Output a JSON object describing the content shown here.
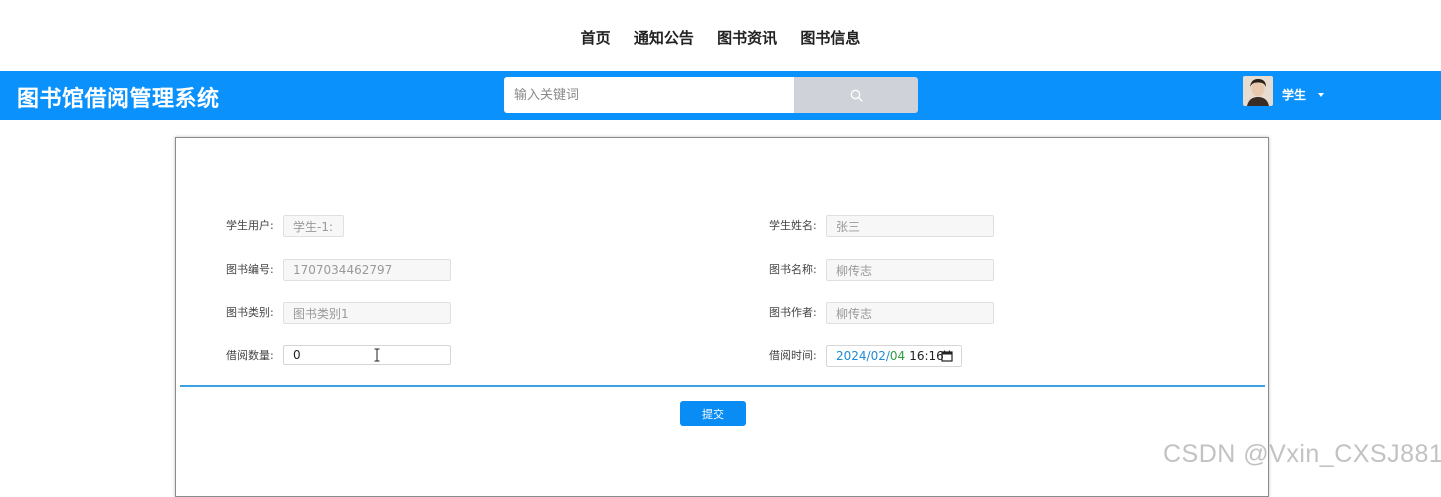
{
  "top_nav": {
    "items": [
      "首页",
      "通知公告",
      "图书资讯",
      "图书信息"
    ]
  },
  "header": {
    "title": "图书馆借阅管理系统",
    "search_placeholder": "输入关键词",
    "user_name": "学生",
    "brand_color": "#0a91fc"
  },
  "form": {
    "fields_left": [
      {
        "label": "学生用户:",
        "value": "学生-1:"
      },
      {
        "label": "图书编号:",
        "value": "1707034462797"
      },
      {
        "label": "图书类别:",
        "value": "图书类别1"
      },
      {
        "label": "借阅数量:",
        "value": "0"
      }
    ],
    "fields_right": [
      {
        "label": "学生姓名:",
        "value": "张三"
      },
      {
        "label": "图书名称:",
        "value": "柳传志"
      },
      {
        "label": "图书作者:",
        "value": "柳传志"
      },
      {
        "label": "借阅时间:",
        "value": ""
      }
    ],
    "date": {
      "year": "2024",
      "month": "02",
      "day": "04",
      "time": "16:16"
    },
    "submit_label": "提交"
  },
  "watermark": "CSDN @Vxin_CXSJ881"
}
